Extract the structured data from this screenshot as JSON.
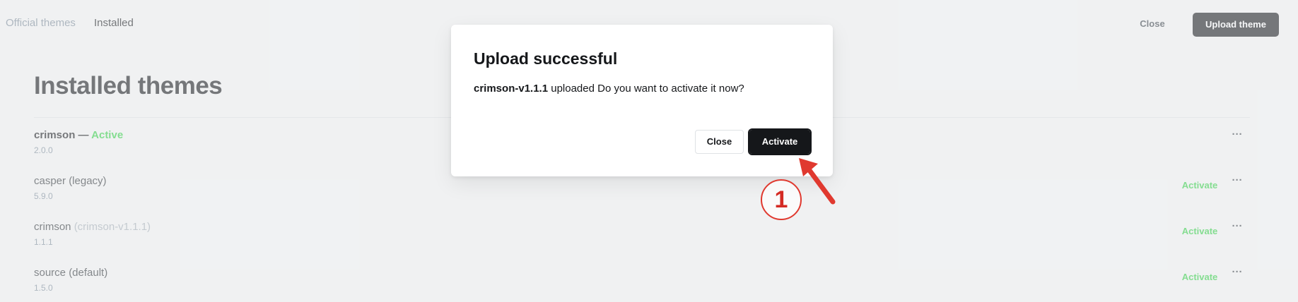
{
  "nav": {
    "tab_official": "Official themes",
    "tab_installed": "Installed",
    "close_label": "Close",
    "upload_label": "Upload theme"
  },
  "page": {
    "title": "Installed themes"
  },
  "themes": [
    {
      "name": "crimson",
      "separator": " — ",
      "status": "Active",
      "version": "2.0.0",
      "more": "···"
    },
    {
      "name": "casper (legacy)",
      "version": "5.9.0",
      "action": "Activate",
      "more": "···"
    },
    {
      "name": "crimson",
      "package": "(crimson-v1.1.1)",
      "version": "1.1.1",
      "action": "Activate",
      "more": "···"
    },
    {
      "name": "source (default)",
      "version": "1.5.0",
      "action": "Activate",
      "more": "···"
    }
  ],
  "modal": {
    "title": "Upload successful",
    "package_name": "crimson-v1.1.1",
    "message": "uploaded Do you want to activate it now?",
    "close_label": "Close",
    "activate_label": "Activate"
  },
  "annotation": {
    "step_number": "1",
    "color": "#e0392f"
  },
  "colors": {
    "accent_green": "#30cf43",
    "primary_dark": "#15171a"
  },
  "icons": {
    "more": "more-horizontal-icon",
    "arrow": "red-pointer-arrow-icon"
  }
}
